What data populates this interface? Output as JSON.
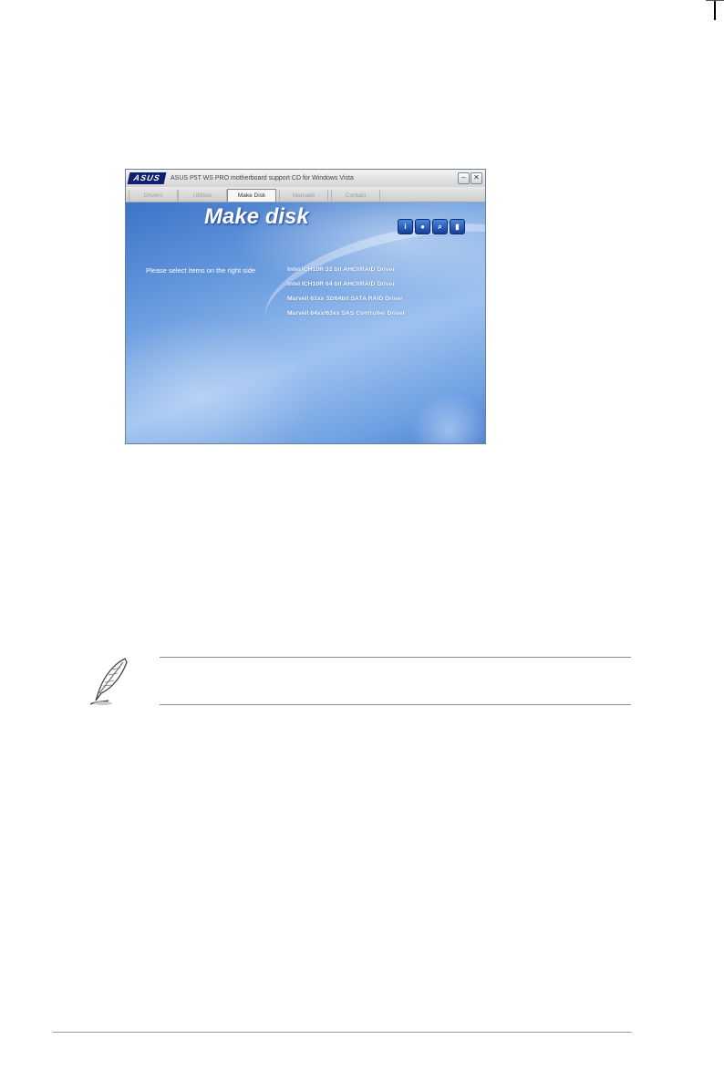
{
  "window": {
    "logo_text": "ASUS",
    "title": "ASUS P5T WS PRO motherboard support CD for Windows Vista",
    "min_glyph": "–",
    "close_glyph": "✕"
  },
  "tabs": [
    {
      "label": "Drivers",
      "active": false
    },
    {
      "label": "Utilities",
      "active": false
    },
    {
      "label": "Make Disk",
      "active": true
    },
    {
      "label": "Manuals",
      "active": false
    },
    {
      "label": "Contact",
      "active": false
    }
  ],
  "content": {
    "heading": "Make disk",
    "hint": "Please select items on the right side",
    "drivers": [
      "Intel ICH10R 32 bit AHCI/RAID Driver",
      "Intel ICH10R 64 bit AHCI/RAID Driver",
      "Marvell 61xx 32/64bit SATA RAID Driver",
      "Marvell 64xx/63xx SAS Controller Driver"
    ],
    "toolbar_icons": [
      {
        "name": "info-icon",
        "glyph": "i"
      },
      {
        "name": "cd-icon",
        "glyph": "●"
      },
      {
        "name": "search-icon",
        "glyph": "⌕"
      },
      {
        "name": "exit-icon",
        "glyph": "▮"
      }
    ]
  },
  "colors": {
    "accent": "#3d74c8",
    "tab_bar": "#d9d9d9",
    "logo": "#0d1f6e"
  }
}
